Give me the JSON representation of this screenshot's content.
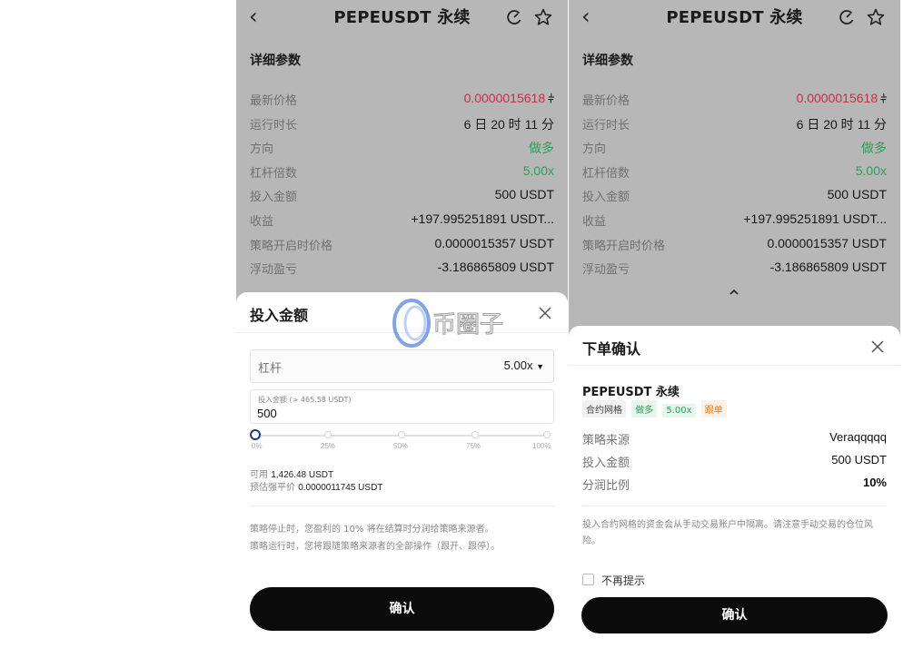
{
  "header": {
    "title": "PEPEUSDT 永续"
  },
  "details": {
    "title": "详细参数",
    "rows": [
      {
        "label": "最新价格",
        "value": "0.0000015618"
      },
      {
        "label": "运行时长",
        "value": "6 日 20 时 11 分"
      },
      {
        "label": "方向",
        "value": "做多"
      },
      {
        "label": "杠杆倍数",
        "value": "5.00x"
      },
      {
        "label": "投入金额",
        "value": "500 USDT"
      },
      {
        "label": "收益",
        "value": "+197.995251891 USDT..."
      },
      {
        "label": "策略开启时价格",
        "value": "0.0000015357 USDT"
      },
      {
        "label": "浮动盈亏",
        "value": "-3.186865809 USDT"
      }
    ]
  },
  "invest_sheet": {
    "title": "投入金额",
    "leverage_label": "杠杆",
    "leverage_value": "5.00x",
    "amount_label": "投入金额 (> 465.58 USDT)",
    "amount_value": "500",
    "slider_ticks": [
      "0%",
      "25%",
      "50%",
      "75%",
      "100%"
    ],
    "slider_level": 0,
    "available_label": "可用",
    "available_value": "1,426.48 USDT",
    "liq_label": "预估强平价",
    "liq_value": "0.0000011745 USDT",
    "note_1": "策略停止时，您盈利的 10% 将在结算时分润给策略来源者。",
    "note_2": "策略运行时，您将跟随策略来源者的全部操作（跟开、跟停）。",
    "confirm_label": "确认"
  },
  "confirm_sheet": {
    "title": "下单确认",
    "pair": "PEPEUSDT 永续",
    "tags": [
      "合约网格",
      "做多",
      "5.00x",
      "跟单"
    ],
    "rows": [
      {
        "label": "策略来源",
        "value": "Veraqqqqq"
      },
      {
        "label": "投入金额",
        "value": "500 USDT"
      },
      {
        "label": "分润比例",
        "value": "10%"
      }
    ],
    "notice": "投入合约网格的资金会从手动交易账户中隔离。请注意手动交易的仓位风险。",
    "checkbox_label": "不再提示",
    "confirm_label": "确认"
  },
  "watermark": {
    "text": "币圈子"
  },
  "colors": {
    "price_red": "#c0304a",
    "long_green": "#2e9e56",
    "follow_orange": "#e07b22",
    "button_black": "#0b0b0b"
  }
}
